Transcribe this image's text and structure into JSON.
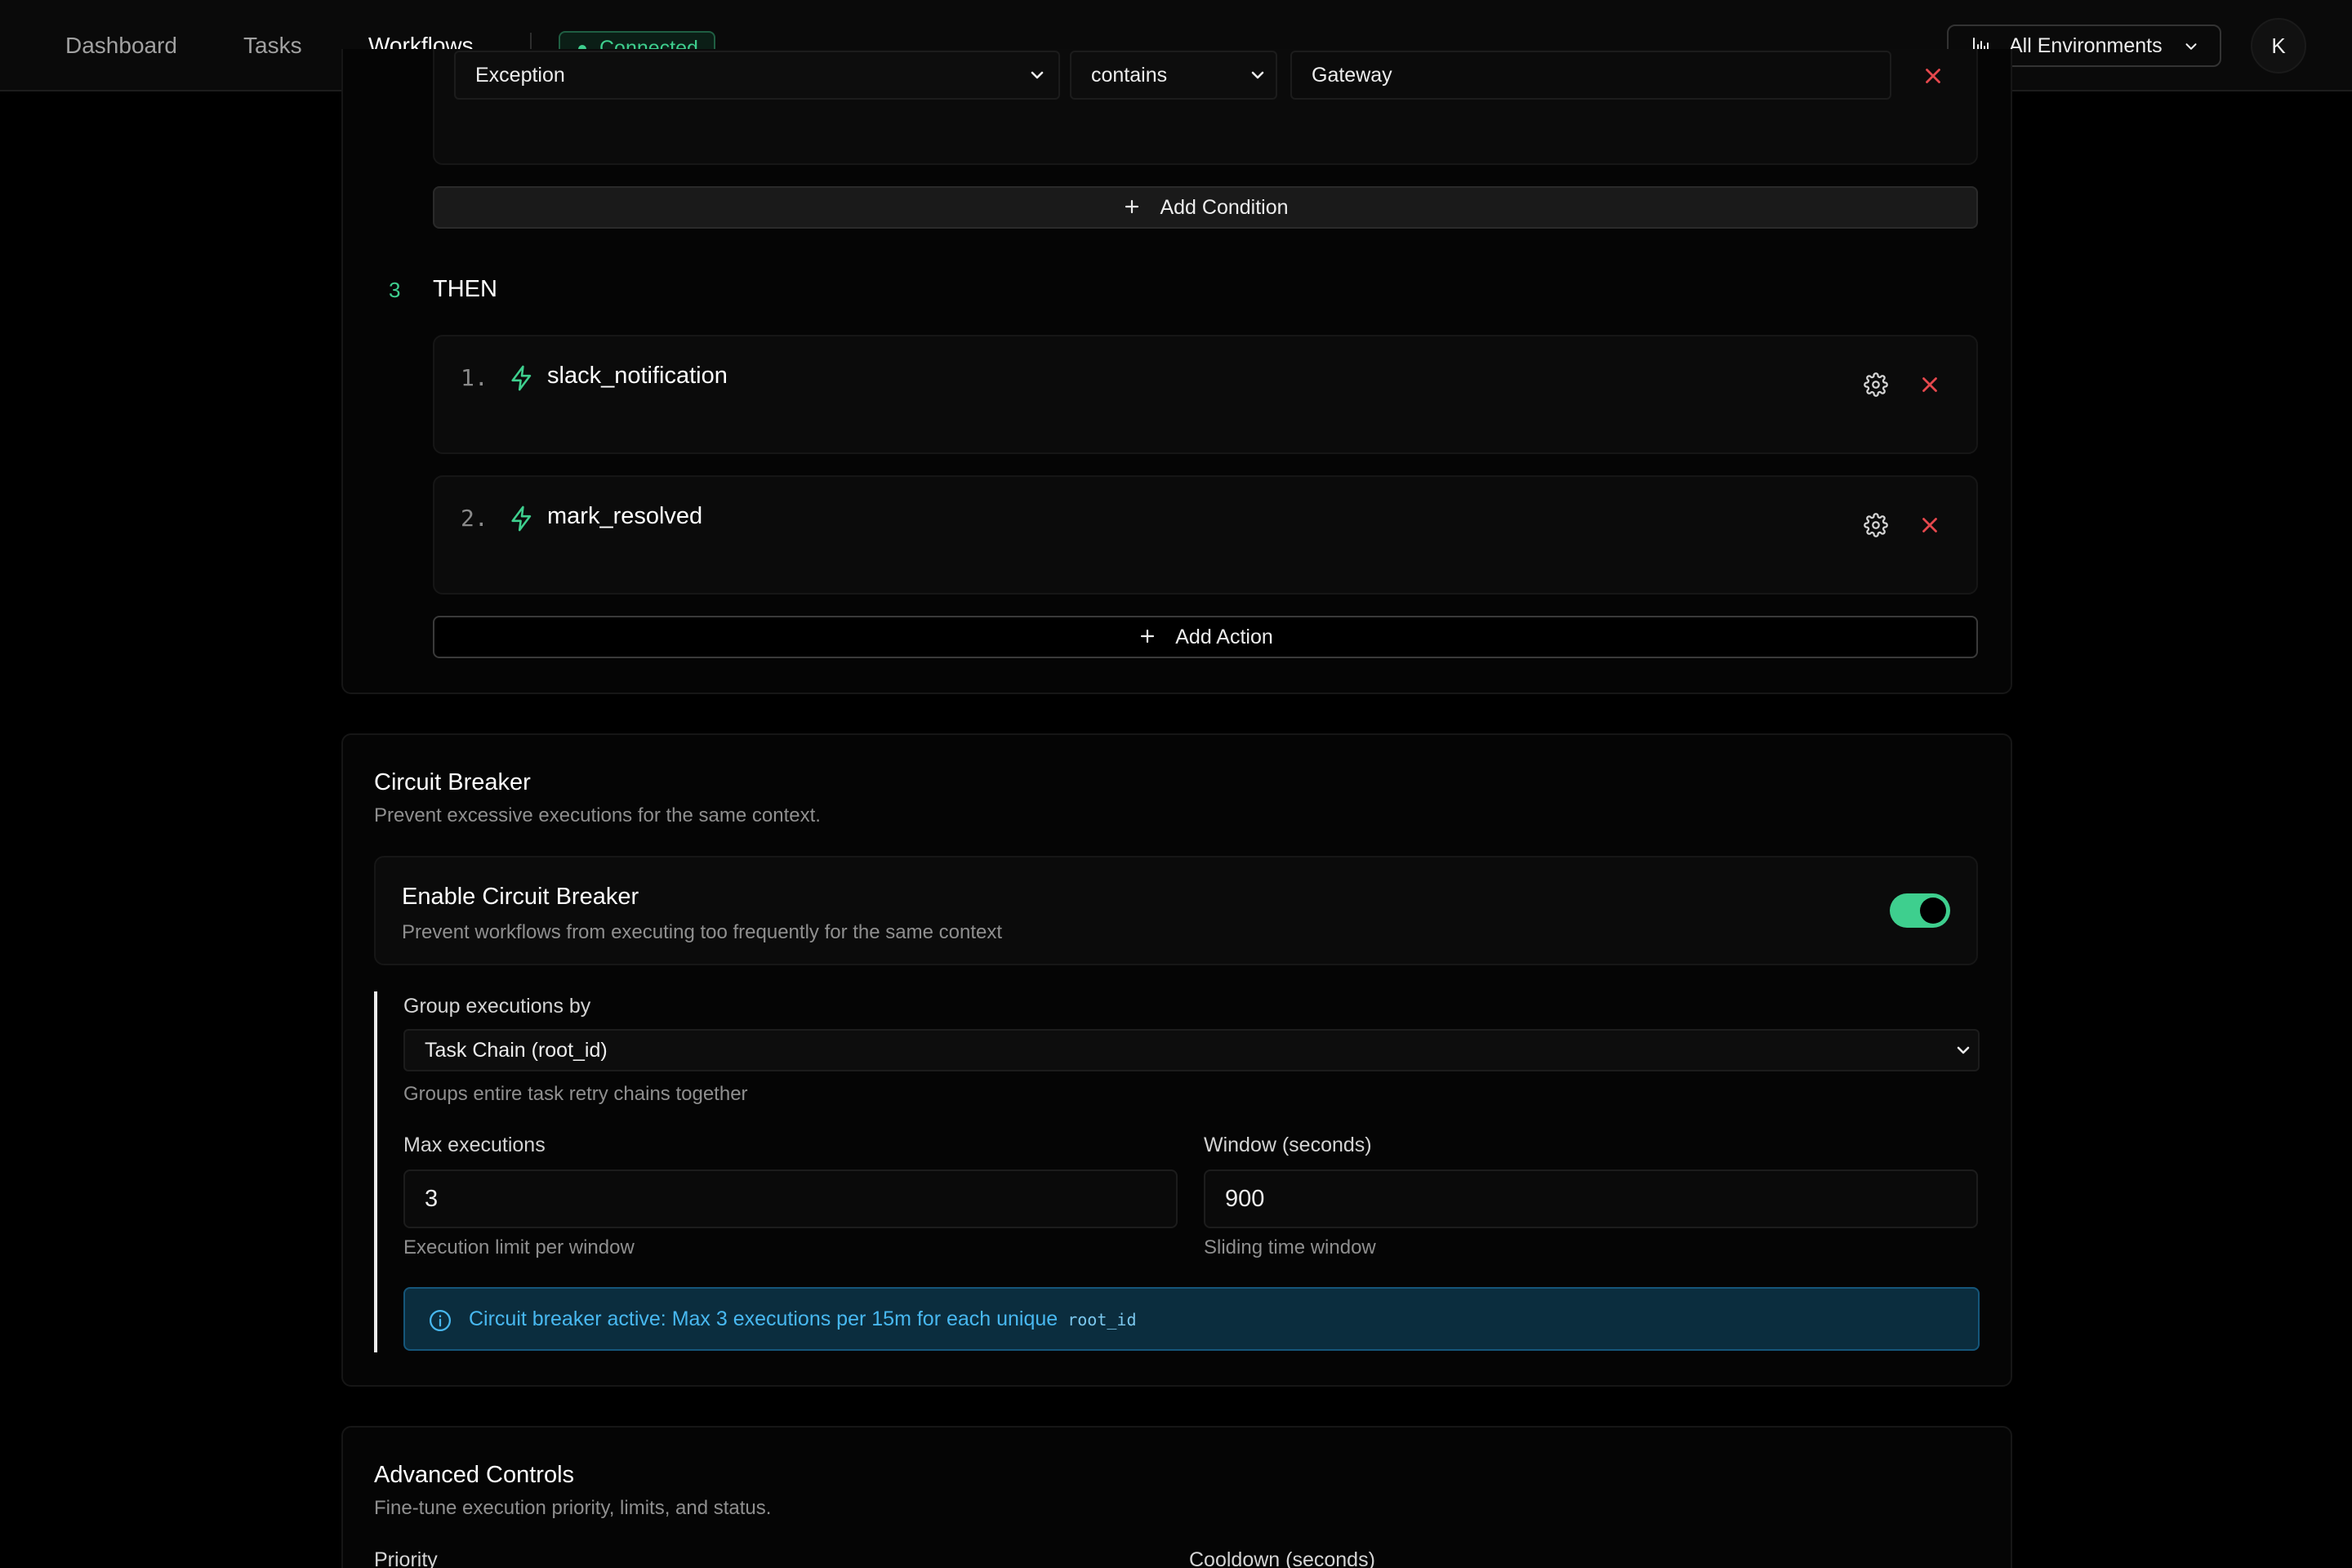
{
  "nav": {
    "tabs": [
      {
        "label": "Dashboard"
      },
      {
        "label": "Tasks"
      },
      {
        "label": "Workflows"
      }
    ],
    "status": "Connected",
    "environment": "All Environments",
    "avatar_initial": "K"
  },
  "conditions": {
    "field": "Exception",
    "operator": "contains",
    "value": "Gateway",
    "add_label": "Add Condition"
  },
  "then": {
    "step_number": "3",
    "title": "THEN",
    "actions": [
      {
        "index": "1.",
        "name": "slack_notification"
      },
      {
        "index": "2.",
        "name": "mark_resolved"
      }
    ],
    "add_label": "Add Action"
  },
  "circuit_breaker": {
    "title": "Circuit Breaker",
    "subtitle": "Prevent excessive executions for the same context.",
    "enable_title": "Enable Circuit Breaker",
    "enable_desc": "Prevent workflows from executing too frequently for the same context",
    "enabled": true,
    "group_label": "Group executions by",
    "group_value": "Task Chain (root_id)",
    "group_help": "Groups entire task retry chains together",
    "max_label": "Max executions",
    "max_value": "3",
    "max_help": "Execution limit per window",
    "window_label": "Window (seconds)",
    "window_value": "900",
    "window_help": "Sliding time window",
    "info_text": "Circuit breaker active: Max 3 executions per 15m for each unique",
    "info_code": "root_id"
  },
  "advanced": {
    "title": "Advanced Controls",
    "subtitle": "Fine-tune execution priority, limits, and status.",
    "priority_label": "Priority",
    "cooldown_label": "Cooldown (seconds)"
  },
  "colors": {
    "accent_green": "#3ecf8e",
    "danger_red": "#e5484d",
    "info_blue": "#48b8f0"
  }
}
